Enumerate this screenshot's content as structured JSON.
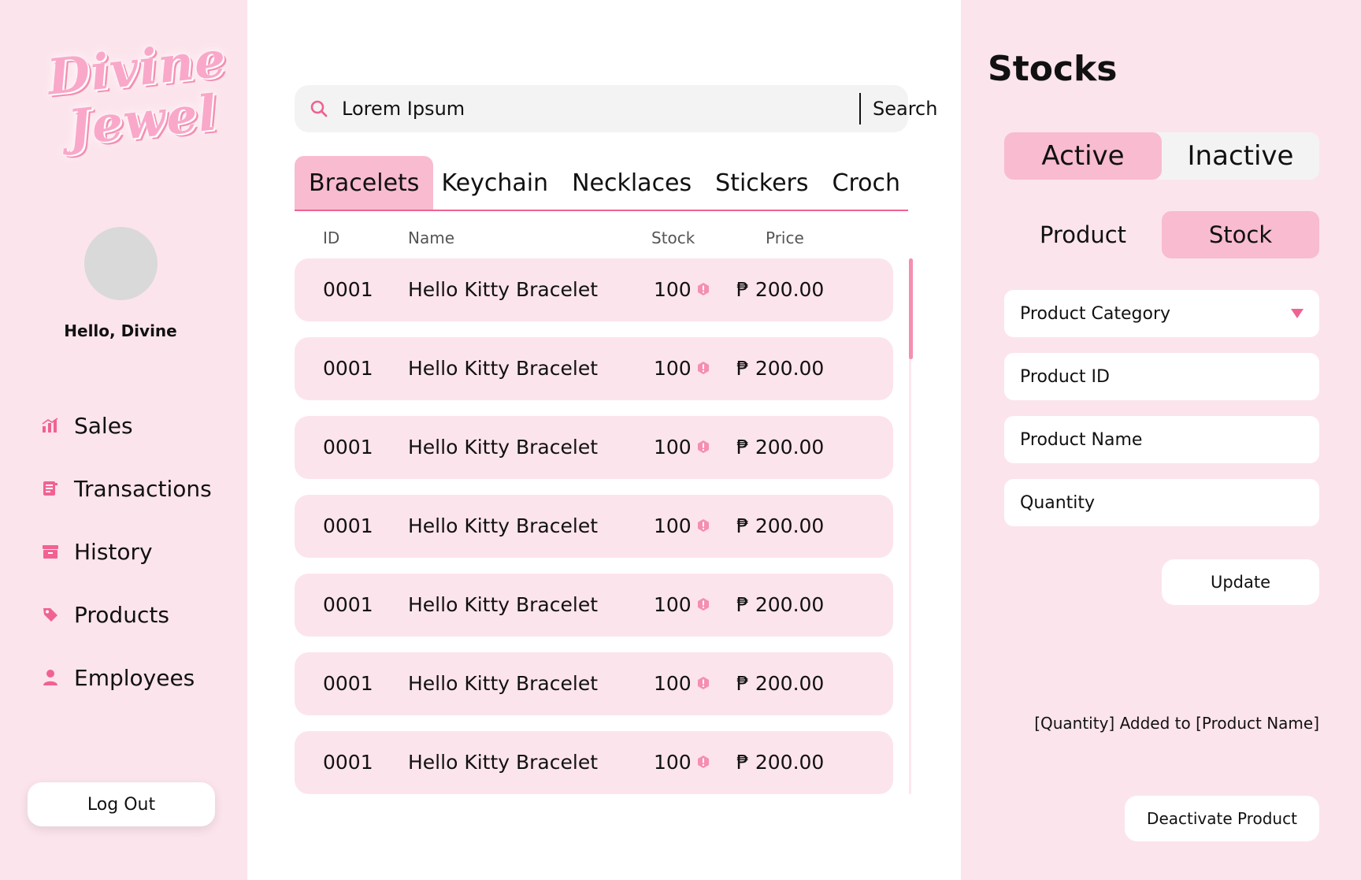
{
  "sidebar": {
    "logo": {
      "line1": "Divine",
      "line2": "Jewel"
    },
    "greeting": "Hello, Divine",
    "nav": [
      {
        "label": "Sales",
        "icon": "bar-chart-icon"
      },
      {
        "label": "Transactions",
        "icon": "receipt-icon"
      },
      {
        "label": "History",
        "icon": "archive-icon"
      },
      {
        "label": "Products",
        "icon": "tag-icon"
      },
      {
        "label": "Employees",
        "icon": "user-icon"
      }
    ],
    "logout_label": "Log Out"
  },
  "main": {
    "search": {
      "value": "Lorem Ipsum",
      "button_label": "Search"
    },
    "tabs": [
      "Bracelets",
      "Keychain",
      "Necklaces",
      "Stickers",
      "Croch"
    ],
    "active_tab": "Bracelets",
    "columns": {
      "id": "ID",
      "name": "Name",
      "stock": "Stock",
      "price": "Price"
    },
    "rows": [
      {
        "id": "0001",
        "name": "Hello Kitty Bracelet",
        "stock": "100",
        "price": "₱ 200.00"
      },
      {
        "id": "0001",
        "name": "Hello Kitty Bracelet",
        "stock": "100",
        "price": "₱ 200.00"
      },
      {
        "id": "0001",
        "name": "Hello Kitty Bracelet",
        "stock": "100",
        "price": "₱ 200.00"
      },
      {
        "id": "0001",
        "name": "Hello Kitty Bracelet",
        "stock": "100",
        "price": "₱ 200.00"
      },
      {
        "id": "0001",
        "name": "Hello Kitty Bracelet",
        "stock": "100",
        "price": "₱ 200.00"
      },
      {
        "id": "0001",
        "name": "Hello Kitty Bracelet",
        "stock": "100",
        "price": "₱ 200.00"
      },
      {
        "id": "0001",
        "name": "Hello Kitty Bracelet",
        "stock": "100",
        "price": "₱ 200.00"
      }
    ]
  },
  "panel": {
    "title": "Stocks",
    "status_toggle": {
      "active": "Active",
      "inactive": "Inactive",
      "selected": "Active"
    },
    "mode_toggle": {
      "product": "Product",
      "stock": "Stock",
      "selected": "Stock"
    },
    "fields": {
      "category": "Product Category",
      "product_id": "Product ID",
      "product_name": "Product Name",
      "quantity": "Quantity"
    },
    "update_label": "Update",
    "notice": "[Quantity] Added to [Product Name]",
    "deactivate_label": "Deactivate Product"
  },
  "colors": {
    "accent": "#f06292",
    "pink_light": "#fce4ec",
    "pink_active": "#f8bbd0"
  }
}
